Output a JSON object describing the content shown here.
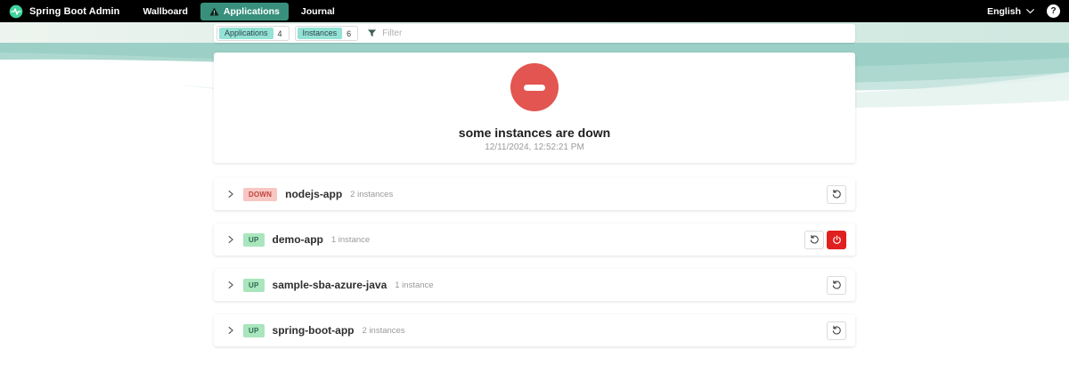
{
  "navbar": {
    "brand": "Spring Boot Admin",
    "items": [
      {
        "label": "Wallboard",
        "active": false
      },
      {
        "label": "Applications",
        "active": true,
        "icon": "warning-triangle-icon"
      },
      {
        "label": "Journal",
        "active": false
      }
    ],
    "language": "English",
    "help_label": "?"
  },
  "filter": {
    "groups": [
      {
        "label": "Applications",
        "count": "4"
      },
      {
        "label": "Instances",
        "count": "6"
      }
    ],
    "filter_icon": "funnel-icon",
    "placeholder": "Filter"
  },
  "status": {
    "icon": "minus-circle-icon",
    "title": "some instances are down",
    "timestamp": "12/11/2024, 12:52:21 PM"
  },
  "applications": [
    {
      "status": "DOWN",
      "status_type": "down",
      "name": "nodejs-app",
      "instances": "2 instances",
      "has_shutdown_button": false
    },
    {
      "status": "UP",
      "status_type": "up",
      "name": "demo-app",
      "instances": "1 instance",
      "has_shutdown_button": true
    },
    {
      "status": "UP",
      "status_type": "up",
      "name": "sample-sba-azure-java",
      "instances": "1 instance",
      "has_shutdown_button": false
    },
    {
      "status": "UP",
      "status_type": "up",
      "name": "spring-boot-app",
      "instances": "2 instances",
      "has_shutdown_button": false
    }
  ],
  "row_action_icons": {
    "restart": "restart-history-icon",
    "shutdown": "power-icon"
  },
  "colors": {
    "navbar_bg": "#000000",
    "accent_teal": "#38907c",
    "brand_green": "#41d49b",
    "chip_teal": "#93e2d5",
    "danger_red": "#e35550",
    "shutdown_red": "#e0201f",
    "badge_down_bg": "#f8c7c3",
    "badge_down_text": "#c0463e",
    "badge_up_bg": "#aae6bd",
    "badge_up_text": "#2e6b52"
  }
}
